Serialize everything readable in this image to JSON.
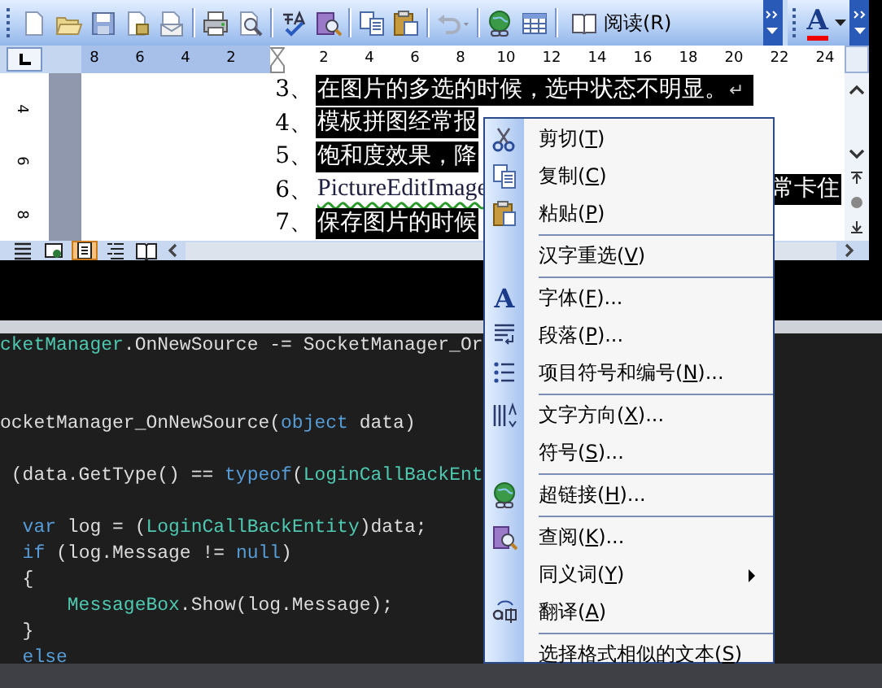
{
  "toolbar": {
    "read_button": "阅读(R)",
    "font_color_glyph": "A"
  },
  "ruler": {
    "left_numbers": [
      "8",
      "6",
      "4",
      "2"
    ],
    "right_numbers": [
      "2",
      "4",
      "6",
      "8",
      "10",
      "12",
      "14",
      "16",
      "18",
      "20",
      "22",
      "24"
    ],
    "vertical_numbers": [
      "4",
      "6",
      "8"
    ]
  },
  "document": {
    "lines": [
      {
        "number": "3、",
        "segments": [
          {
            "text": "在图片的多选的时候，选中状态不明显。",
            "selected": true,
            "kind": "text"
          }
        ],
        "mark": "↵"
      },
      {
        "number": "4、",
        "segments": [
          {
            "text": "模板拼图经常报",
            "selected": true,
            "kind": "text"
          }
        ]
      },
      {
        "number": "5、",
        "segments": [
          {
            "text": "饱和度效果，降",
            "selected": true,
            "kind": "text"
          }
        ]
      },
      {
        "number": "6、",
        "segments": [
          {
            "text": "PictureEditImage",
            "selected": false,
            "flagged": true,
            "kind": "text"
          },
          {
            "text": "常卡住",
            "selected": true,
            "kind": "tail"
          }
        ]
      },
      {
        "number": "7、",
        "segments": [
          {
            "text": "保存图片的时候",
            "selected": true,
            "kind": "text"
          }
        ]
      }
    ]
  },
  "view_buttons": [
    {
      "selected": false
    },
    {
      "selected": false
    },
    {
      "selected": true
    },
    {
      "selected": false
    },
    {
      "selected": false
    }
  ],
  "code": {
    "lines": [
      {
        "kind": "code",
        "tokens": [
          {
            "text": "cketManager",
            "kind": "type"
          },
          {
            "text": ".OnNewSource -= SocketManager_Or",
            "kind": "plain"
          }
        ]
      },
      {
        "kind": "blank"
      },
      {
        "kind": "blank"
      },
      {
        "kind": "code",
        "tokens": [
          {
            "text": "ocketManager_OnNewSource(",
            "kind": "plain"
          },
          {
            "text": "object",
            "kind": "keyword"
          },
          {
            "text": " data)",
            "kind": "plain"
          }
        ]
      },
      {
        "kind": "blank"
      },
      {
        "kind": "code",
        "tokens": [
          {
            "text": " (data.GetType() == ",
            "kind": "plain"
          },
          {
            "text": "typeof",
            "kind": "keyword"
          },
          {
            "text": "(",
            "kind": "plain"
          },
          {
            "text": "LoginCallBackEnt",
            "kind": "type"
          }
        ]
      },
      {
        "kind": "blank"
      },
      {
        "kind": "code",
        "tokens": [
          {
            "text": "  var",
            "kind": "keyword"
          },
          {
            "text": " log = (",
            "kind": "plain"
          },
          {
            "text": "LoginCallBackEntity",
            "kind": "type"
          },
          {
            "text": ")data;",
            "kind": "plain"
          }
        ]
      },
      {
        "kind": "code",
        "tokens": [
          {
            "text": "  if",
            "kind": "keyword"
          },
          {
            "text": " (log.Message != ",
            "kind": "plain"
          },
          {
            "text": "null",
            "kind": "keyword"
          },
          {
            "text": ")",
            "kind": "plain"
          }
        ]
      },
      {
        "kind": "code",
        "tokens": [
          {
            "text": "  {",
            "kind": "plain"
          }
        ]
      },
      {
        "kind": "code",
        "tokens": [
          {
            "text": "      MessageBox",
            "kind": "type"
          },
          {
            "text": ".Show(log.Message);",
            "kind": "plain"
          }
        ]
      },
      {
        "kind": "code",
        "tokens": [
          {
            "text": "  }",
            "kind": "plain"
          }
        ]
      },
      {
        "kind": "code",
        "tokens": [
          {
            "text": "  else",
            "kind": "keyword"
          }
        ]
      }
    ]
  },
  "context_menu": {
    "items": [
      {
        "label": "剪切(T)",
        "kind": "scissors",
        "submenu": false
      },
      {
        "label": "复制(C)",
        "kind": "copy",
        "submenu": false
      },
      {
        "label": "粘贴(P)",
        "kind": "paste",
        "submenu": false
      },
      {
        "kind": "separator"
      },
      {
        "label": "汉字重选(V)",
        "kind": "plain",
        "submenu": false
      },
      {
        "kind": "separator"
      },
      {
        "label": "字体(F)...",
        "kind": "glyph",
        "glyph": "A",
        "submenu": false
      },
      {
        "label": "段落(P)...",
        "kind": "paragraph",
        "submenu": false
      },
      {
        "label": "项目符号和编号(N)...",
        "kind": "list",
        "submenu": false
      },
      {
        "kind": "separator"
      },
      {
        "label": "文字方向(X)...",
        "kind": "direction",
        "submenu": false
      },
      {
        "label": "符号(S)...",
        "kind": "plain",
        "submenu": false
      },
      {
        "kind": "separator"
      },
      {
        "label": "超链接(H)...",
        "kind": "globe",
        "submenu": false
      },
      {
        "kind": "separator"
      },
      {
        "label": "查阅(K)...",
        "kind": "research",
        "submenu": false
      },
      {
        "label": "同义词(Y)",
        "kind": "plain",
        "submenu": true
      },
      {
        "label": "翻译(A)",
        "kind": "translate",
        "submenu": false
      },
      {
        "kind": "separator"
      },
      {
        "label": "选择格式相似的文本(S)",
        "kind": "plain",
        "submenu": false
      }
    ]
  }
}
